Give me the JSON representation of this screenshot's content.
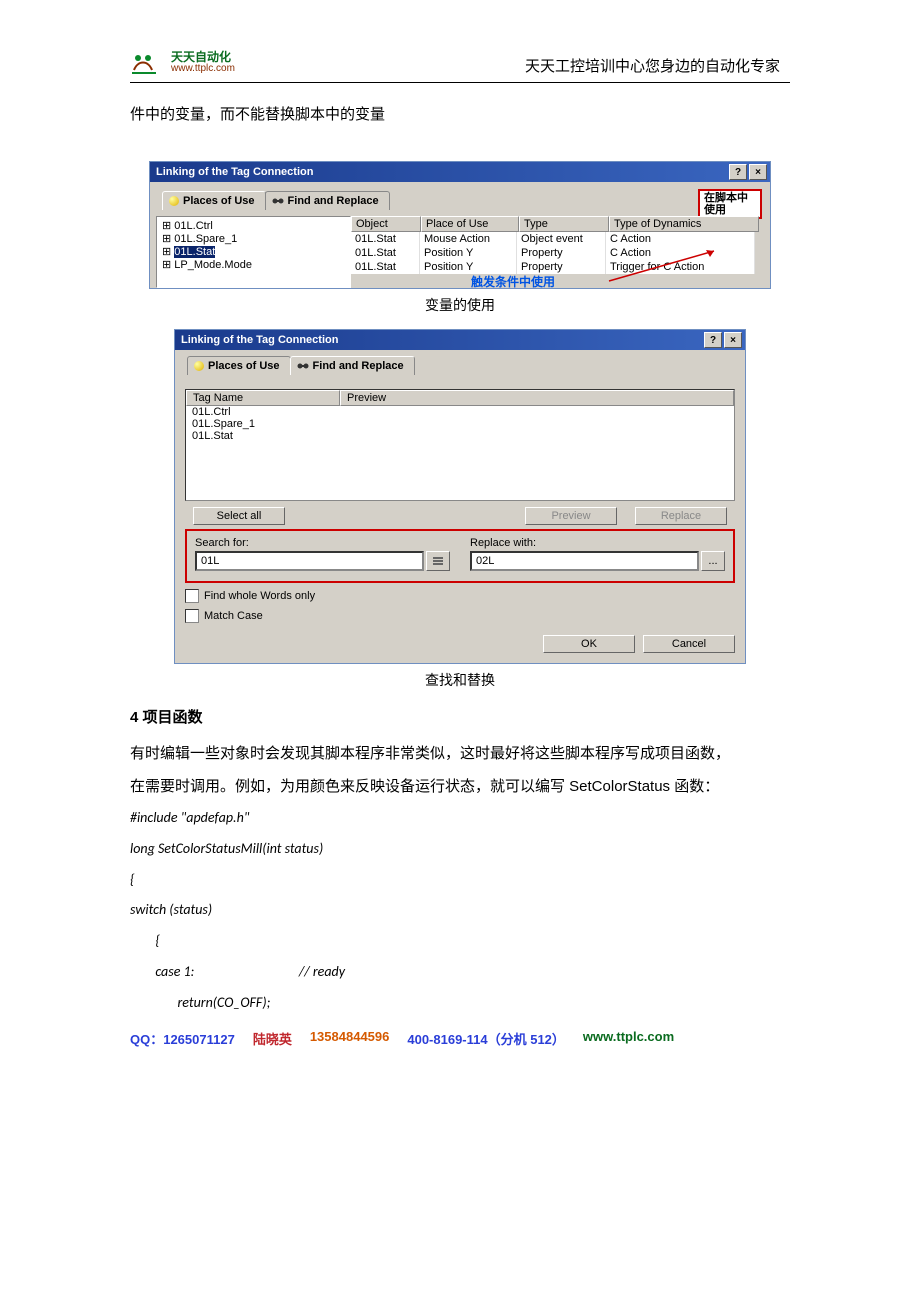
{
  "header": {
    "logo_cn": "天天自动化",
    "logo_url": "www.ttplc.com",
    "title": "天天工控培训中心您身边的自动化专家"
  },
  "intro_text": "件中的变量，而不能替换脚本中的变量",
  "dialog1": {
    "title": "Linking of the Tag Connection",
    "tab1": "Places of Use",
    "tab2": "Find and Replace",
    "annot_right": "在脚本中使用",
    "tree": [
      "01L.Ctrl",
      "01L.Spare_1",
      "01L.Stat",
      "LP_Mode.Mode"
    ],
    "tree_selected_index": 2,
    "cols": {
      "object": "Object",
      "pou": "Place of Use",
      "type": "Type",
      "dyn": "Type of Dynamics"
    },
    "rows": [
      {
        "object": "01L.Stat",
        "pou": "Mouse Action",
        "type": "Object event",
        "dyn": "C Action"
      },
      {
        "object": "01L.Stat",
        "pou": "Position Y",
        "type": "Property",
        "dyn": "C Action"
      },
      {
        "object": "01L.Stat",
        "pou": "Position Y",
        "type": "Property",
        "dyn": "Trigger for C Action"
      }
    ],
    "annot_bottom": "触发条件中使用",
    "caption": "变量的使用"
  },
  "dialog2": {
    "title": "Linking of the Tag Connection",
    "tab1": "Places of Use",
    "tab2": "Find and Replace",
    "col_tag": "Tag Name",
    "col_prev": "Preview",
    "tags": [
      "01L.Ctrl",
      "01L.Spare_1",
      "01L.Stat"
    ],
    "btn_selectall": "Select all",
    "btn_preview": "Preview",
    "btn_replace": "Replace",
    "search_label": "Search for:",
    "search_value": "01L",
    "replace_label": "Replace with:",
    "replace_value": "02L",
    "chk_whole": "Find whole Words only",
    "chk_case": "Match Case",
    "btn_ok": "OK",
    "btn_cancel": "Cancel",
    "ellipsis": "...",
    "caption": "查找和替换"
  },
  "sec4_title": "4 项目函数",
  "sec4_p1": "有时编辑一些对象时会发现其脚本程序非常类似，这时最好将这些脚本程序写成项目函数，",
  "sec4_p2": "在需要时调用。例如，为用颜色来反映设备运行状态，就可以编写 SetColorStatus 函数：",
  "code": [
    "#include \"apdefap.h\"",
    "long SetColorStatusMill(int status)",
    "{",
    "switch (status)",
    "        {",
    "        case 1:                                 // ready",
    "               return(CO_OFF);"
  ],
  "footer": {
    "qq": "QQ：1265071127",
    "name": "陆晓英",
    "phone": "13584844596",
    "hotline": "400-8169-114（分机 512）",
    "url": "www.ttplc.com"
  }
}
